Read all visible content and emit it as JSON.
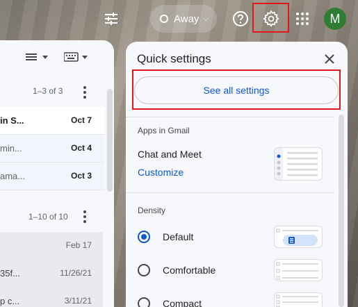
{
  "topbar": {
    "status_label": "Away",
    "avatar_initial": "M",
    "avatar_color": "#2f7d32",
    "highlight_color": "#e0181b",
    "icons": [
      "filter-icon",
      "help-icon",
      "gear-icon",
      "apps-icon"
    ]
  },
  "mail": {
    "sections": [
      {
        "count": "1–3 of 3",
        "rows": [
          {
            "sender": "in S...",
            "date": "Oct 7",
            "style": "bold"
          },
          {
            "sender": "min...",
            "date": "Oct 4",
            "style": "bold"
          },
          {
            "sender": "ama...",
            "date": "Oct 3",
            "style": "bold"
          }
        ]
      },
      {
        "count": "1–10 of 10",
        "rows": [
          {
            "sender": "",
            "date": "Feb 17",
            "style": "grey"
          },
          {
            "sender": "35f...",
            "date": "11/26/21",
            "style": "grey"
          },
          {
            "sender": "p c...",
            "date": "3/11/21",
            "style": "grey"
          }
        ]
      }
    ]
  },
  "quick_settings": {
    "title": "Quick settings",
    "see_all": "See all settings",
    "apps_section": "Apps in Gmail",
    "chat_label": "Chat and Meet",
    "customize_label": "Customize",
    "density_section": "Density",
    "density_options": [
      {
        "label": "Default",
        "checked": true
      },
      {
        "label": "Comfortable",
        "checked": false
      },
      {
        "label": "Compact",
        "checked": false
      }
    ],
    "accent_color": "#0b57d0"
  }
}
